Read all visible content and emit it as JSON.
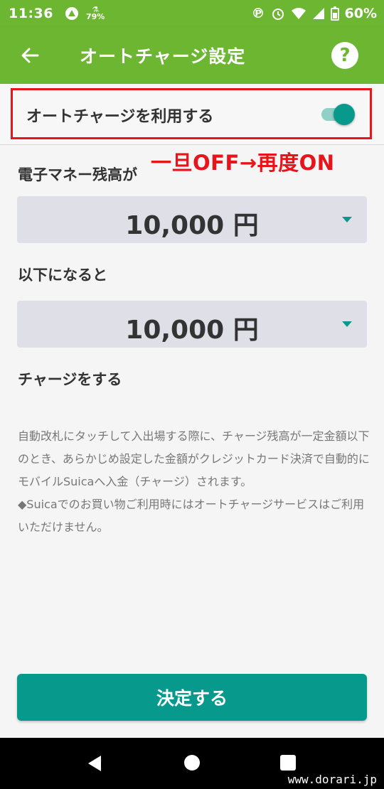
{
  "status_bar": {
    "time": "11:36",
    "mini_label": "79%",
    "battery": "60%"
  },
  "app_bar": {
    "title": "オートチャージ設定",
    "help": "?"
  },
  "toggle_row": {
    "label": "オートチャージを利用する",
    "enabled": true
  },
  "annotation": "一旦OFF→再度ON",
  "balance": {
    "label": "電子マネー残高が",
    "value": "10,000 円"
  },
  "threshold": {
    "label": "以下になると",
    "value": "10,000 円"
  },
  "charge_label": "チャージをする",
  "description": [
    "自動改札にタッチして入出場する際に、チャージ残高が一定金額以下のとき、あらかじめ設定した金額がクレジットカード決済で自動的にモバイルSuicaへ入金（チャージ）されます。",
    "◆Suicaでのお買い物ご利用時にはオートチャージサービスはご利用いただけません。"
  ],
  "submit": "決定する",
  "watermark": "www.dorari.jp",
  "colors": {
    "brand_green": "#6db631",
    "accent_teal": "#079a8c",
    "annotation_red": "#e8141c"
  }
}
